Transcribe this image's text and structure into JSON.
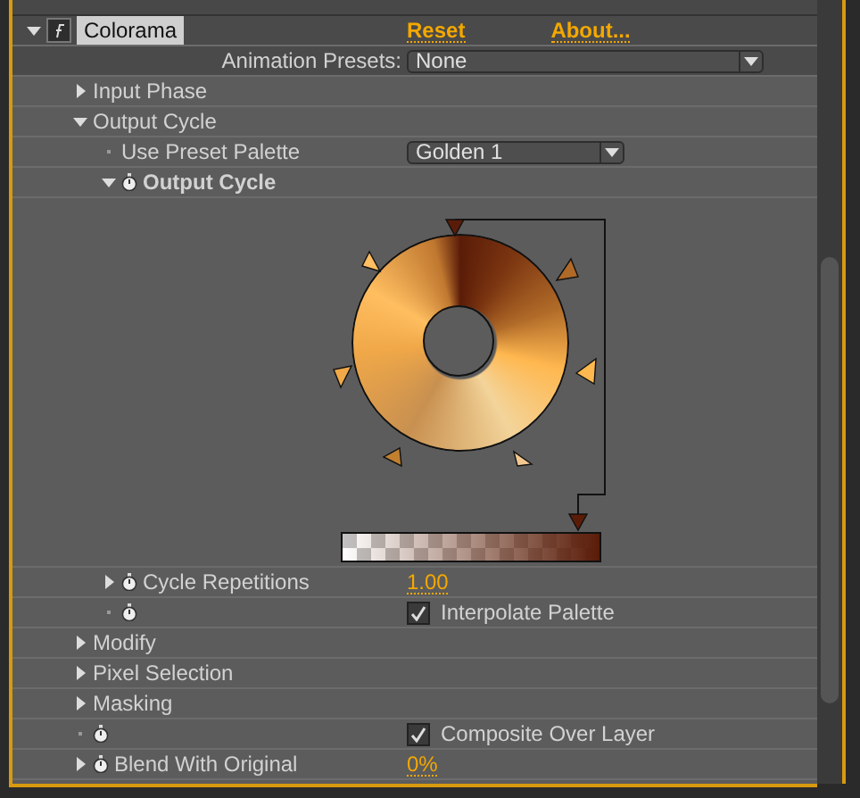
{
  "effect": {
    "name": "Colorama",
    "selected": true,
    "expanded": true,
    "links": [
      "Reset",
      "About..."
    ],
    "presets": {
      "label": "Animation Presets:",
      "value": "None"
    }
  },
  "properties": [
    {
      "kind": "group",
      "label": "Input Phase",
      "expanded": false
    },
    {
      "kind": "group",
      "label": "Output Cycle",
      "expanded": true,
      "children": [
        {
          "kind": "dropdown",
          "label": "Use Preset Palette",
          "value": "Golden 1",
          "stopwatch": false
        },
        {
          "kind": "graphic",
          "label": "Output Cycle",
          "expanded": true,
          "stopwatch": true
        },
        {
          "kind": "value",
          "label": "Cycle Repetitions",
          "value": "1.00",
          "expanded": false,
          "stopwatch": true
        },
        {
          "kind": "checkbox",
          "text": "Interpolate Palette",
          "checked": true,
          "stopwatch": true
        }
      ]
    },
    {
      "kind": "group",
      "label": "Modify",
      "expanded": false
    },
    {
      "kind": "group",
      "label": "Pixel Selection",
      "expanded": false
    },
    {
      "kind": "group",
      "label": "Masking",
      "expanded": false
    },
    {
      "kind": "checkbox",
      "text": "Composite Over Layer",
      "checked": true,
      "stopwatch": true
    },
    {
      "kind": "value",
      "label": "Blend With Original",
      "value": "0%",
      "expanded": false,
      "stopwatch": true
    }
  ]
}
